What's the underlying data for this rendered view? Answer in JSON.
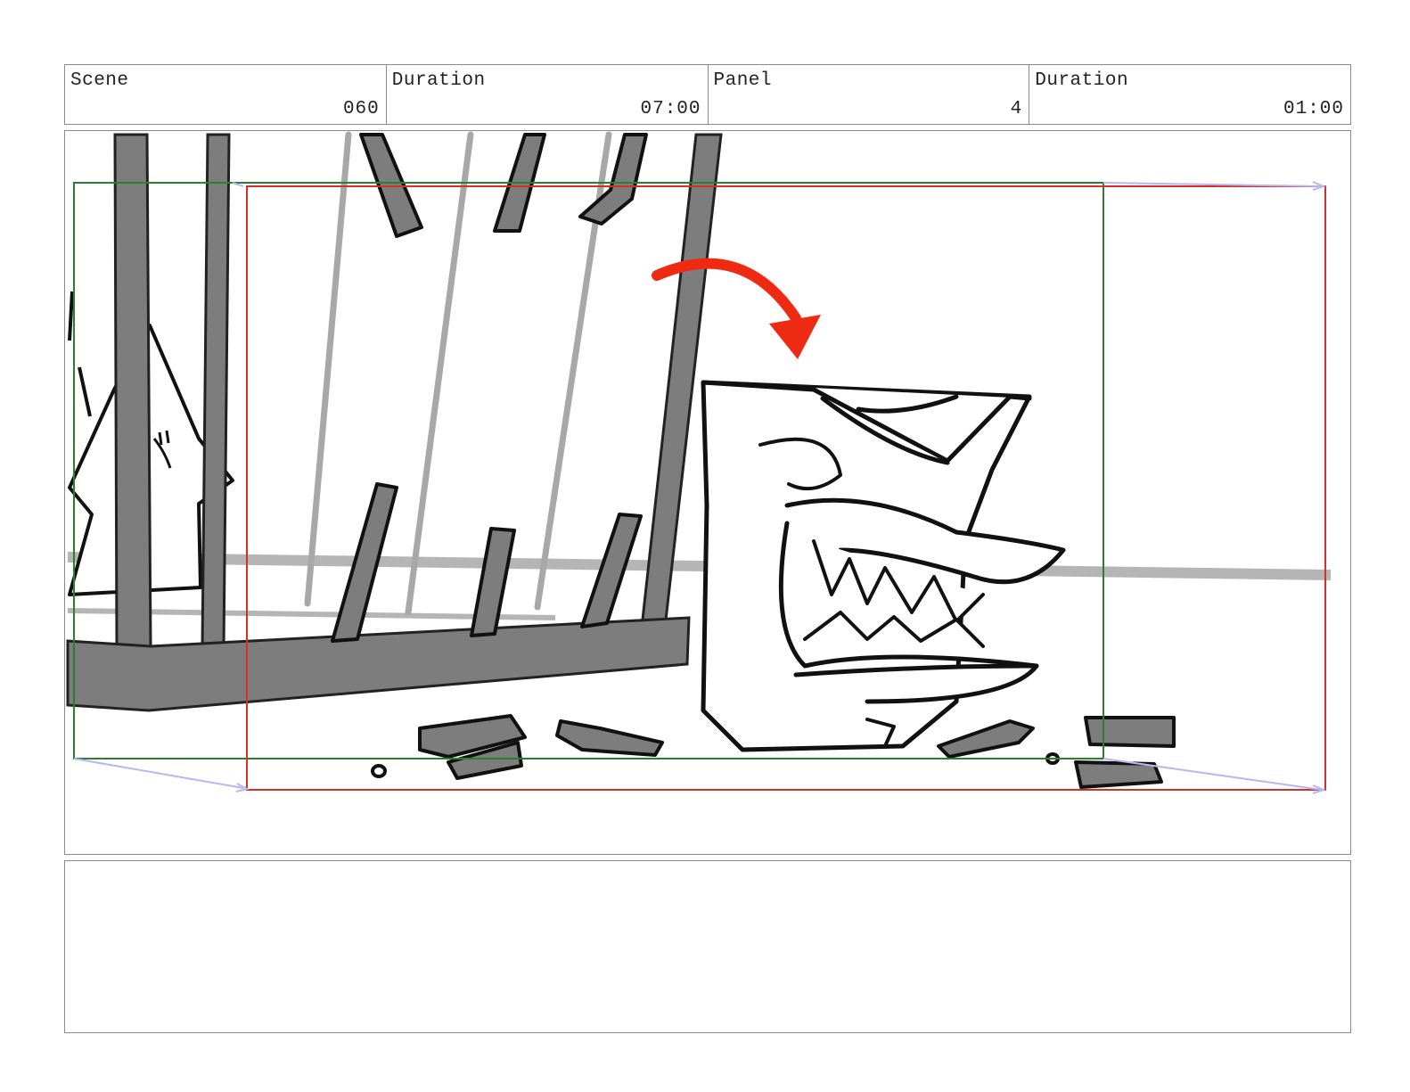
{
  "header": {
    "scene_label": "Scene",
    "scene_value": "060",
    "scene_duration_label": "Duration",
    "scene_duration_value": "07:00",
    "panel_label": "Panel",
    "panel_value": "4",
    "panel_duration_label": "Duration",
    "panel_duration_value": "01:00"
  },
  "colors": {
    "border": "#8a8a8a",
    "camera_start_frame": "#2e7d32",
    "camera_end_frame": "#d32f2f",
    "camera_move_arrow": "#b7b7f0",
    "action_arrow": "#ee2b12",
    "bars": "#7d7d7d"
  },
  "drawing": {
    "icon": "storyboard-sketch",
    "subjects": [
      "cage",
      "broken-bars",
      "star-character",
      "monster-face",
      "red-action-arrow"
    ]
  },
  "notes": {
    "text": ""
  }
}
